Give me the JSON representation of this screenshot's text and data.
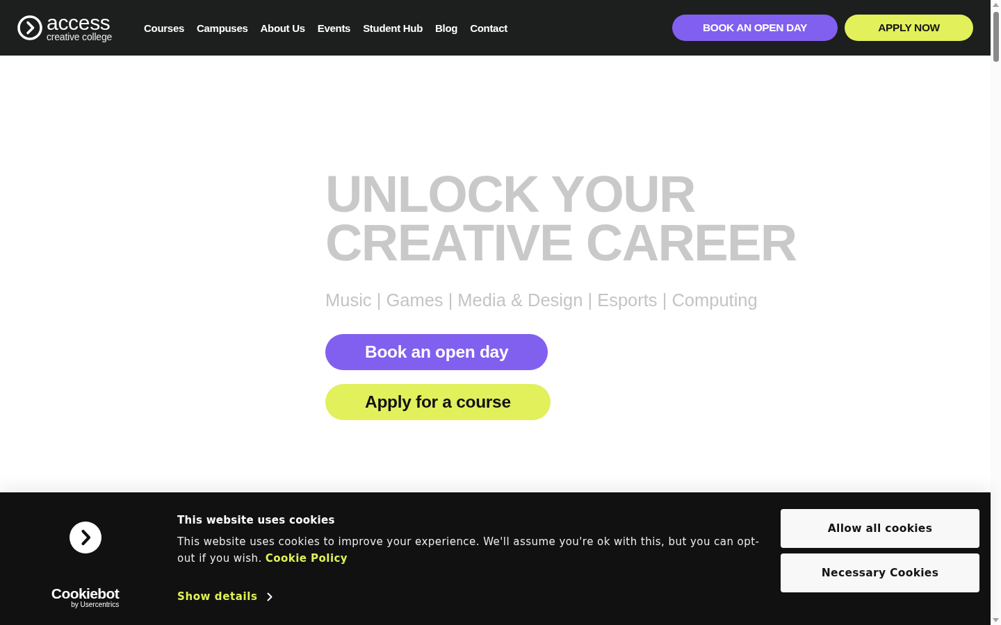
{
  "header": {
    "logo": {
      "name": "access",
      "tagline": "creative college"
    },
    "nav": [
      "Courses",
      "Campuses",
      "About Us",
      "Events",
      "Student Hub",
      "Blog",
      "Contact"
    ],
    "buttons": [
      {
        "label": "BOOK AN OPEN DAY",
        "kind": "primary"
      },
      {
        "label": "APPLY NOW",
        "kind": "accent"
      }
    ]
  },
  "hero": {
    "title": "UNLOCK YOUR CREATIVE CAREER",
    "subtitle": "Music | Games | Media & Design | Esports | Computing",
    "buttons": [
      {
        "label": "Book an open day",
        "kind": "primary"
      },
      {
        "label": "Apply for a course",
        "kind": "accent"
      }
    ]
  },
  "cookie_banner": {
    "brand": {
      "name": "Cookiebot",
      "byline": "by Usercentrics"
    },
    "title": "This website uses cookies",
    "message": "This website uses cookies to improve your experience. We'll assume you're ok with this, but you can opt-out if you wish.",
    "policy_link": "Cookie Policy",
    "details_link": "Show details",
    "buttons": [
      "Allow all cookies",
      "Necessary Cookies"
    ]
  }
}
